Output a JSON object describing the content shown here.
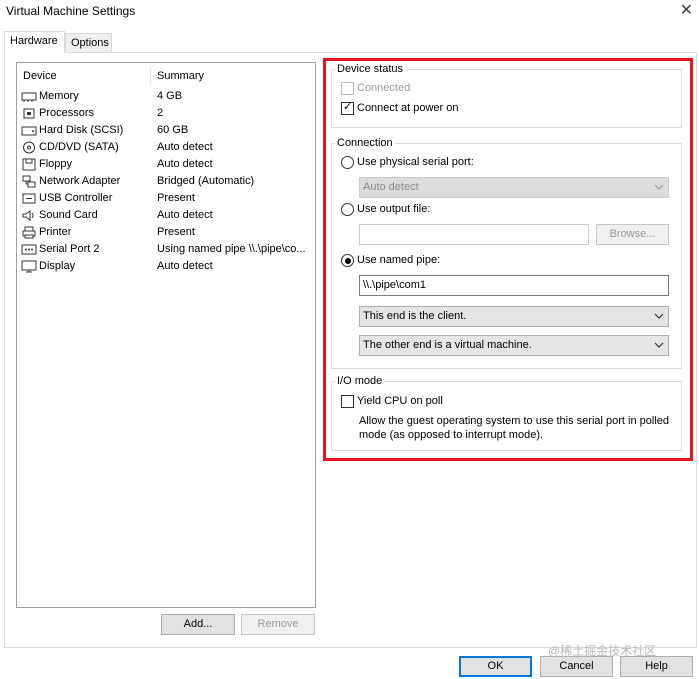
{
  "window": {
    "title": "Virtual Machine Settings"
  },
  "tabs": [
    {
      "label": "Hardware"
    },
    {
      "label": "Options"
    }
  ],
  "device_list": {
    "columns": {
      "device": "Device",
      "summary": "Summary"
    },
    "rows": [
      {
        "name": "Memory",
        "summary": "4 GB",
        "icon": "memory-icon"
      },
      {
        "name": "Processors",
        "summary": "2",
        "icon": "processor-icon"
      },
      {
        "name": "Hard Disk (SCSI)",
        "summary": "60 GB",
        "icon": "hard-disk-icon"
      },
      {
        "name": "CD/DVD (SATA)",
        "summary": "Auto detect",
        "icon": "cd-dvd-icon"
      },
      {
        "name": "Floppy",
        "summary": "Auto detect",
        "icon": "floppy-icon"
      },
      {
        "name": "Network Adapter",
        "summary": "Bridged (Automatic)",
        "icon": "network-adapter-icon"
      },
      {
        "name": "USB Controller",
        "summary": "Present",
        "icon": "usb-icon"
      },
      {
        "name": "Sound Card",
        "summary": "Auto detect",
        "icon": "speaker-icon"
      },
      {
        "name": "Printer",
        "summary": "Present",
        "icon": "printer-icon"
      },
      {
        "name": "Serial Port 2",
        "summary": "Using named pipe \\\\.\\pipe\\co...",
        "icon": "serial-port-icon"
      },
      {
        "name": "Display",
        "summary": "Auto detect",
        "icon": "display-icon"
      }
    ]
  },
  "list_buttons": {
    "add": "Add...",
    "remove": "Remove"
  },
  "device_status": {
    "label": "Device status",
    "connected": {
      "label": "Connected",
      "checked": false,
      "enabled": false
    },
    "connect_at_power_on": {
      "label": "Connect at power on",
      "checked": true
    }
  },
  "connection": {
    "label": "Connection",
    "physical": {
      "label": "Use physical serial port:",
      "selected": false,
      "combo_value": "Auto detect"
    },
    "output_file": {
      "label": "Use output file:",
      "selected": false,
      "value": "",
      "browse": "Browse..."
    },
    "named_pipe": {
      "label": "Use named pipe:",
      "selected": true,
      "pipe_name": "\\\\.\\pipe\\com1",
      "this_end": "This end is the client.",
      "other_end": "The other end is a virtual machine."
    }
  },
  "io_mode": {
    "label": "I/O mode",
    "yield_cpu": {
      "label": "Yield CPU on poll",
      "checked": false
    },
    "description": "Allow the guest operating system to use this serial port in polled mode (as opposed to interrupt mode)."
  },
  "dialog_buttons": {
    "ok": "OK",
    "cancel": "Cancel",
    "help": "Help"
  },
  "watermark": "@稀土掘金技术社区",
  "colors": {
    "highlight_box": "#e8141e",
    "default_button_border": "#0078d7"
  }
}
